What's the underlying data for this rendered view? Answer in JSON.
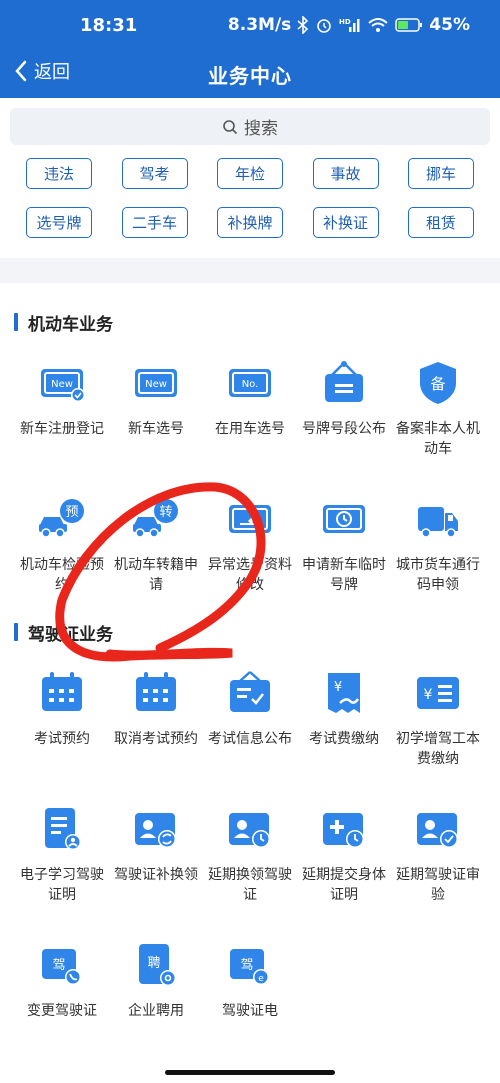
{
  "status_bar": {
    "time": "18:31",
    "net_speed": "8.3M/s",
    "battery": "45%"
  },
  "nav": {
    "back_label": "返回",
    "title": "业务中心"
  },
  "search": {
    "placeholder": "搜索"
  },
  "quick_chips": [
    "违法",
    "驾考",
    "年检",
    "事故",
    "挪车",
    "选号牌",
    "二手车",
    "补换牌",
    "补换证",
    "租赁"
  ],
  "sections": [
    {
      "title": "机动车业务",
      "items": [
        {
          "label": "新车注册登记",
          "icon": "new-plate-check-icon"
        },
        {
          "label": "新车选号",
          "icon": "new-plate-icon"
        },
        {
          "label": "在用车选号",
          "icon": "number-plate-icon"
        },
        {
          "label": "号牌号段公布",
          "icon": "hanging-sign-icon"
        },
        {
          "label": "备案非本人机动车",
          "icon": "shield-record-icon"
        },
        {
          "label": "机动车检验预约",
          "icon": "car-appointment-icon"
        },
        {
          "label": "机动车转籍申请",
          "icon": "car-transfer-icon"
        },
        {
          "label": "异常选号资料修改",
          "icon": "edit-card-icon"
        },
        {
          "label": "申请新车临时号牌",
          "icon": "temp-plate-clock-icon"
        },
        {
          "label": "城市货车通行码申领",
          "icon": "truck-icon"
        }
      ]
    },
    {
      "title": "驾驶证业务",
      "items": [
        {
          "label": "考试预约",
          "icon": "calendar-icon"
        },
        {
          "label": "取消考试预约",
          "icon": "calendar-cancel-icon"
        },
        {
          "label": "考试信息公布",
          "icon": "exam-info-icon"
        },
        {
          "label": "考试费缴纳",
          "icon": "fee-receipt-icon"
        },
        {
          "label": "初学增驾工本费缴纳",
          "icon": "yuan-list-icon"
        },
        {
          "label": "电子学习驾驶证明",
          "icon": "e-study-icon"
        },
        {
          "label": "驾驶证补换领",
          "icon": "license-renew-icon"
        },
        {
          "label": "延期换领驾驶证",
          "icon": "license-delay-icon"
        },
        {
          "label": "延期提交身体证明",
          "icon": "health-delay-icon"
        },
        {
          "label": "延期驾驶证审验",
          "icon": "license-check-icon"
        },
        {
          "label": "变更驾驶证",
          "icon": "license-change-icon"
        },
        {
          "label": "企业聘用",
          "icon": "employ-icon"
        },
        {
          "label": "驾驶证电",
          "icon": "e-license-icon"
        }
      ]
    }
  ],
  "colors": {
    "primary": "#1f6dd1",
    "annotation": "#e8261c"
  }
}
